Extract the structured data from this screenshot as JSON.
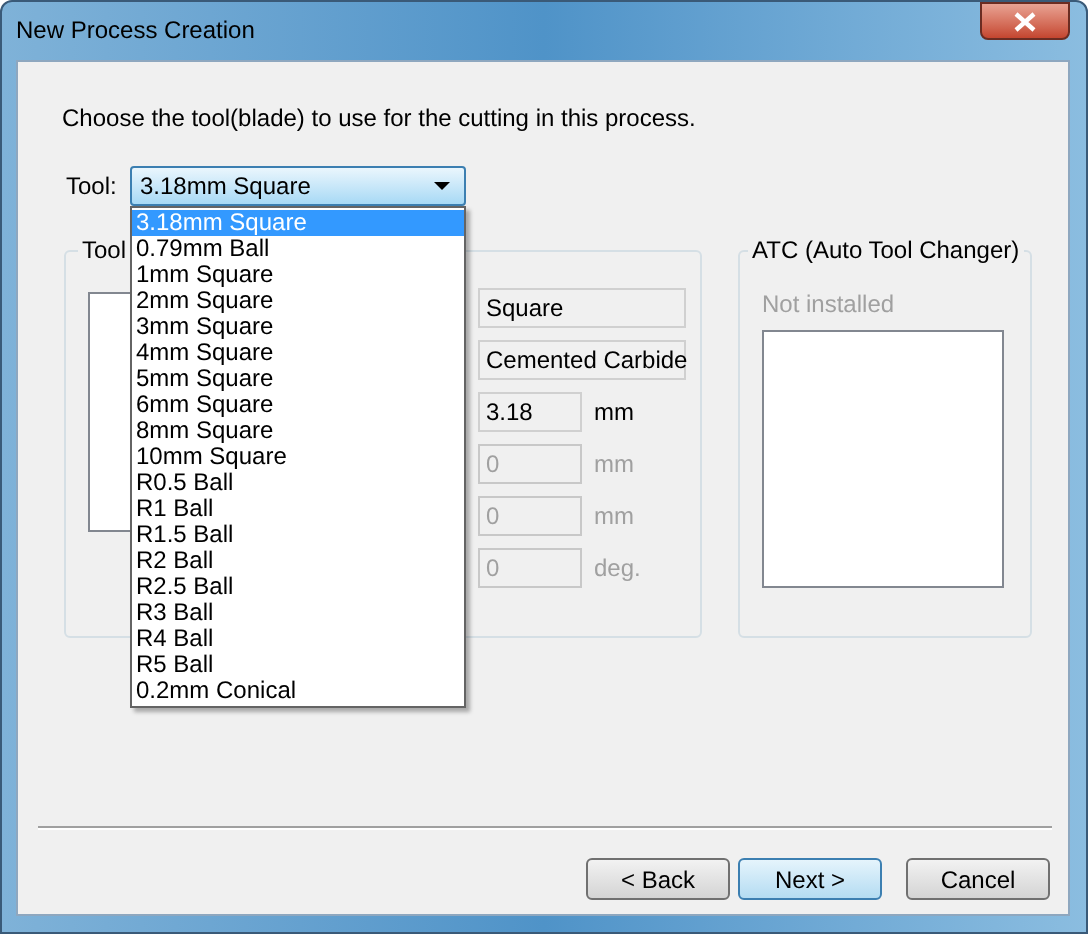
{
  "window": {
    "title": "New Process Creation"
  },
  "instruction": "Choose the tool(blade) to use for the cutting in this process.",
  "tool_selector": {
    "label": "Tool:",
    "value": "3.18mm Square",
    "expanded": true,
    "options": [
      {
        "label": "3.18mm Square",
        "selected": true
      },
      {
        "label": "0.79mm Ball",
        "selected": false
      },
      {
        "label": "1mm Square",
        "selected": false
      },
      {
        "label": "2mm Square",
        "selected": false
      },
      {
        "label": "3mm Square",
        "selected": false
      },
      {
        "label": "4mm Square",
        "selected": false
      },
      {
        "label": "5mm Square",
        "selected": false
      },
      {
        "label": "6mm Square",
        "selected": false
      },
      {
        "label": "8mm Square",
        "selected": false
      },
      {
        "label": "10mm Square",
        "selected": false
      },
      {
        "label": "R0.5 Ball",
        "selected": false
      },
      {
        "label": "R1 Ball",
        "selected": false
      },
      {
        "label": "R1.5 Ball",
        "selected": false
      },
      {
        "label": "R2 Ball",
        "selected": false
      },
      {
        "label": "R2.5 Ball",
        "selected": false
      },
      {
        "label": "R3 Ball",
        "selected": false
      },
      {
        "label": "R4 Ball",
        "selected": false
      },
      {
        "label": "R5 Ball",
        "selected": false
      },
      {
        "label": "0.2mm Conical",
        "selected": false
      }
    ]
  },
  "tool_group": {
    "title": "Tool",
    "fields": [
      {
        "value": "Square",
        "disabled": false
      },
      {
        "value": "Cemented Carbide",
        "disabled": false
      },
      {
        "value": "3.18",
        "unit": "mm",
        "disabled": false
      },
      {
        "value": "0",
        "unit": "mm",
        "disabled": true
      },
      {
        "value": "0",
        "unit": "mm",
        "disabled": true
      },
      {
        "value": "0",
        "unit": "deg.",
        "disabled": true
      }
    ]
  },
  "atc_group": {
    "title": "ATC (Auto Tool Changer)",
    "status": "Not installed"
  },
  "buttons": [
    {
      "label": "< Back",
      "default": false
    },
    {
      "label": "Next >",
      "default": true
    },
    {
      "label": "Cancel",
      "default": false
    }
  ]
}
